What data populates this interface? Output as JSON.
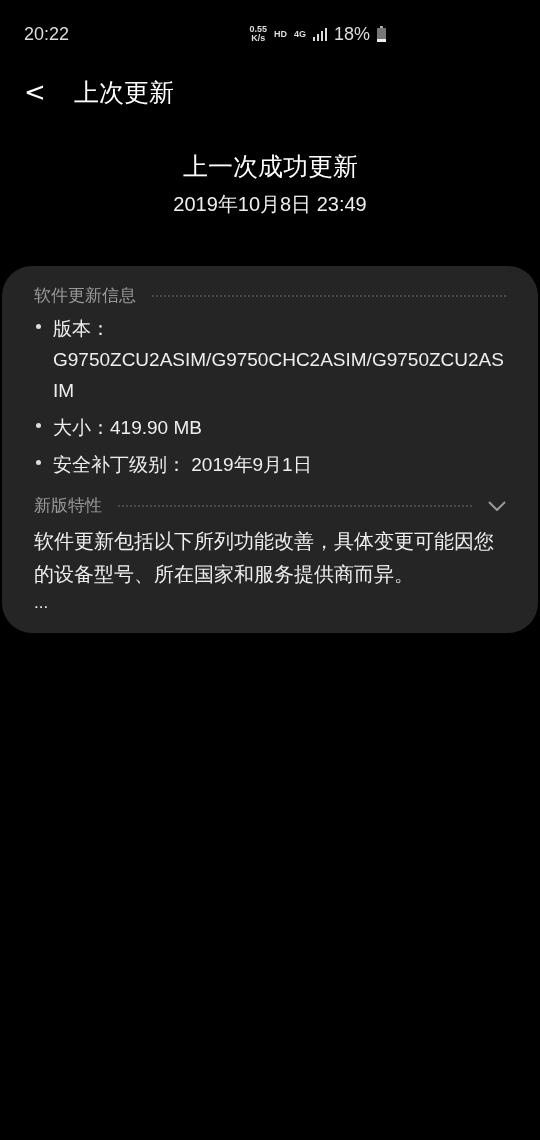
{
  "status_bar": {
    "time": "20:22",
    "net_speed": "0.55",
    "net_unit": "K/s",
    "hd": "HD",
    "network": "4G",
    "battery": "18%"
  },
  "header": {
    "back": "<",
    "title": "上次更新"
  },
  "summary": {
    "title": "上一次成功更新",
    "date": "2019年10月8日 23:49"
  },
  "card": {
    "info_title": "软件更新信息",
    "info_items": [
      "版本：G9750ZCU2ASIM/G9750CHC2ASIM/G9750ZCU2ASIM",
      "大小：419.90 MB",
      "安全补丁级别： 2019年9月1日"
    ],
    "features_title": "新版特性",
    "features_text": "软件更新包括以下所列功能改善，具体变更可能因您的设备型号、所在国家和服务提供商而异。",
    "features_more": "..."
  }
}
